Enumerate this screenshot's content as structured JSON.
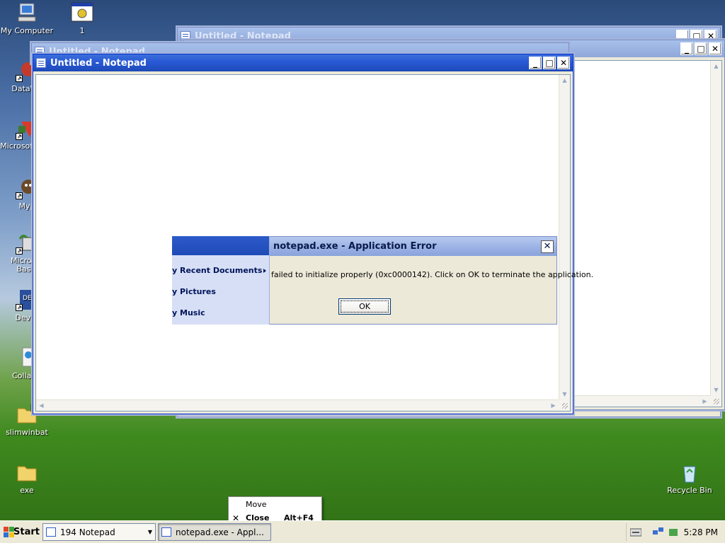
{
  "desktop": {
    "icons": [
      {
        "label": "My Computer",
        "icon": "computer-icon"
      },
      {
        "label": "1",
        "icon": "program-icon"
      },
      {
        "label": "DataWa",
        "icon": "app-shortcut-icon"
      },
      {
        "label": "Microsof C++",
        "icon": "app-shortcut-icon"
      },
      {
        "label": "Myp",
        "icon": "app-shortcut-icon"
      },
      {
        "label": "Microsof Basic",
        "icon": "app-shortcut-icon"
      },
      {
        "label": "Dev-C",
        "icon": "app-shortcut-icon"
      },
      {
        "label": "CollabV",
        "icon": "app-shortcut-icon"
      },
      {
        "label": "slimwinbat",
        "icon": "folder-icon"
      },
      {
        "label": "exe",
        "icon": "folder-icon"
      },
      {
        "label": "Recycle Bin",
        "icon": "recycle-bin-icon"
      }
    ]
  },
  "windows": {
    "back1": {
      "title": "Untitled - Notepad"
    },
    "back2": {
      "title": "Untitled - Notepad"
    },
    "back3": {
      "title": "Untitled - Notepad"
    },
    "front": {
      "title": "Untitled - Notepad"
    }
  },
  "title_buttons": {
    "minimize": "_",
    "maximize": "□",
    "close": "✕"
  },
  "error_dialog": {
    "title": "notepad.exe - Application Error",
    "message": "failed to initialize properly (0xc0000142). Click on OK to terminate the application.",
    "ok_label": "OK"
  },
  "start_menu_fragment": {
    "items": [
      "y Recent Documents",
      "y Pictures",
      "y Music"
    ]
  },
  "context_menu": {
    "move_label": "Move",
    "close_label": "Close",
    "close_accel": "Alt+F4"
  },
  "taskbar": {
    "start_label": "Start",
    "group_button": "194 Notepad",
    "error_button": "notepad.exe - Appl...",
    "clock": "5:28 PM"
  },
  "colors": {
    "title_active": "#2a5bd7",
    "title_inactive": "#9cb4e2",
    "taskbar": "#ece9d8"
  }
}
